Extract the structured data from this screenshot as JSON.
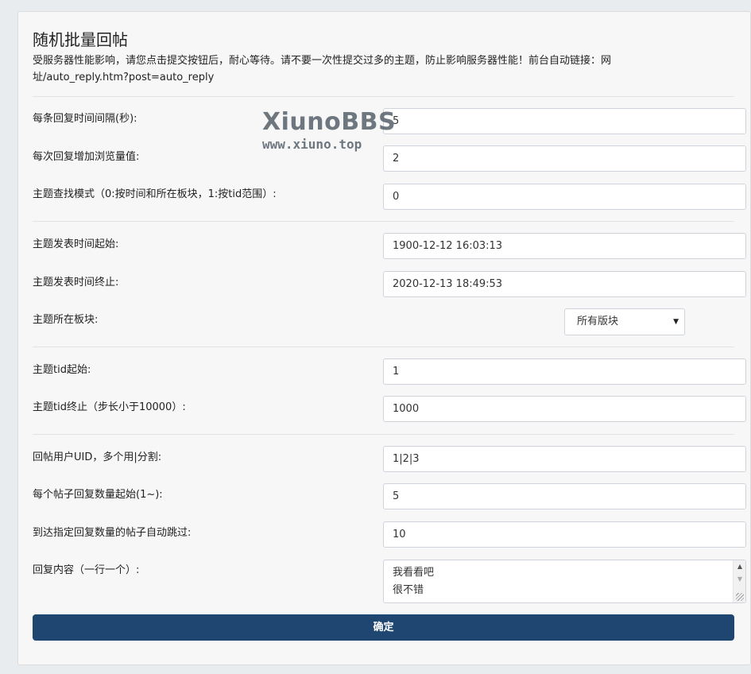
{
  "form": {
    "title": "随机批量回帖",
    "description": "受服务器性能影响，请您点击提交按钮后，耐心等待。请不要一次性提交过多的主题，防止影响服务器性能！前台自动链接：网址/auto_reply.htm?post=auto_reply",
    "fields": {
      "interval": {
        "label": "每条回复时间间隔(秒):",
        "value": "5"
      },
      "views_increment": {
        "label": "每次回复增加浏览量值:",
        "value": "2"
      },
      "search_mode": {
        "label": "主题查找模式（0:按时间和所在板块，1:按tid范围）:",
        "value": "0"
      },
      "time_start": {
        "label": "主题发表时间起始:",
        "value": "1900-12-12 16:03:13"
      },
      "time_end": {
        "label": "主题发表时间终止:",
        "value": "2020-12-13 18:49:53"
      },
      "forum": {
        "label": "主题所在板块:",
        "selected": "所有版块"
      },
      "tid_start": {
        "label": "主题tid起始:",
        "value": "1"
      },
      "tid_end": {
        "label": "主题tid终止（步长小于10000）:",
        "value": "1000"
      },
      "user_uids": {
        "label": "回帖用户UID，多个用|分割:",
        "value": "1|2|3"
      },
      "reply_count_start": {
        "label": "每个帖子回复数量起始(1~):",
        "value": "5"
      },
      "skip_threshold": {
        "label": "到达指定回复数量的帖子自动跳过:",
        "value": "10"
      },
      "reply_content": {
        "label": "回复内容（一行一个）:",
        "lines": [
          "我看看吧",
          "很不错"
        ]
      }
    },
    "submit_label": "确定"
  },
  "watermark": {
    "brand": "XiunoBBS",
    "url": "www.xiuno.top"
  }
}
